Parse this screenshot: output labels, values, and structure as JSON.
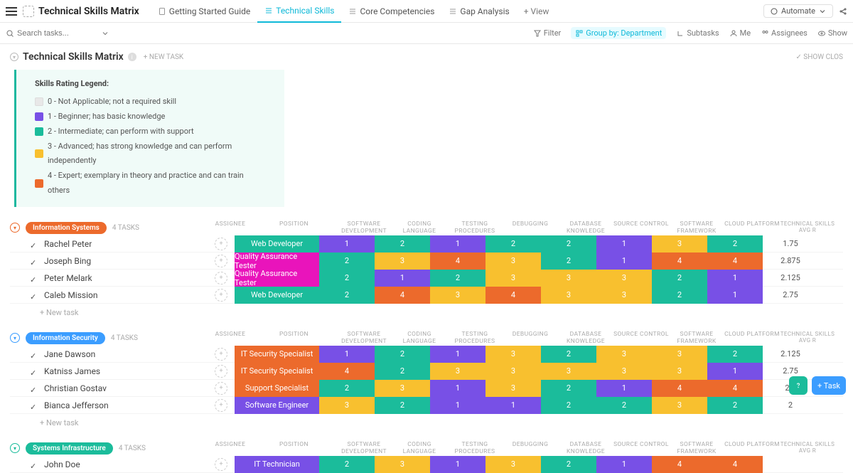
{
  "header": {
    "app_title": "Technical Skills Matrix",
    "tabs": [
      {
        "label": "Getting Started Guide"
      },
      {
        "label": "Technical Skills"
      },
      {
        "label": "Core Competencies"
      },
      {
        "label": "Gap Analysis"
      }
    ],
    "view_add": "+  View",
    "automate": "Automate"
  },
  "search": {
    "placeholder": "Search tasks..."
  },
  "filters": {
    "filter": "Filter",
    "group_by": "Group by: Department",
    "subtasks": "Subtasks",
    "me": "Me",
    "assignees": "Assignees",
    "show": "Show"
  },
  "page": {
    "title": "Technical Skills Matrix",
    "new_task": "+ NEW TASK",
    "show_closed": "✓ SHOW CLOS"
  },
  "legend": {
    "title": "Skills Rating Legend:",
    "rows": [
      {
        "swatch": "s0",
        "text": "0 - Not Applicable; not a required skill"
      },
      {
        "swatch": "s1",
        "text": "1 - Beginner;  has basic knowledge"
      },
      {
        "swatch": "s2",
        "text": "2 - Intermediate; can perform with support"
      },
      {
        "swatch": "s3",
        "text": "3 - Advanced; has strong knowledge and can perform independently"
      },
      {
        "swatch": "s4",
        "text": "4 - Expert; exemplary in theory and practice and can train others"
      }
    ]
  },
  "columns": {
    "assignee": "ASSIGNEE",
    "position": "POSITION",
    "skills": [
      "SOFTWARE DEVELOPMENT",
      "CODING LANGUAGE",
      "TESTING PROCEDURES",
      "DEBUGGING",
      "DATABASE KNOWLEDGE",
      "SOURCE CONTROL",
      "SOFTWARE FRAMEWORK",
      "CLOUD PLATFORM"
    ],
    "avg": "TECHNICAL SKILLS AVG R"
  },
  "skill_colors": {
    "1": "c-purple",
    "2": "c-teal",
    "3": "c-yellow",
    "4": "c-orange"
  },
  "groups": [
    {
      "name": "Information Systems",
      "count_label": "4 TASKS",
      "color": "#ec6a2c",
      "rows": [
        {
          "name": "Rachel Peter",
          "position": "Web Developer",
          "pos_color": "c-teal",
          "skills": [
            1,
            2,
            1,
            2,
            2,
            1,
            3,
            2
          ],
          "avg": "1.75"
        },
        {
          "name": "Joseph Bing",
          "position": "Quality Assurance Tester",
          "pos_color": "c-magenta",
          "skills": [
            2,
            3,
            4,
            3,
            2,
            1,
            4,
            4
          ],
          "avg": "2.875"
        },
        {
          "name": "Peter Melark",
          "position": "Quality Assurance Tester",
          "pos_color": "c-magenta",
          "skills": [
            2,
            1,
            2,
            3,
            3,
            3,
            2,
            1
          ],
          "avg": "2.125"
        },
        {
          "name": "Caleb Mission",
          "position": "Web Developer",
          "pos_color": "c-teal",
          "skills": [
            2,
            4,
            3,
            4,
            3,
            3,
            2,
            1
          ],
          "avg": "2.75"
        }
      ],
      "new_task": "+ New task"
    },
    {
      "name": "Information Security",
      "count_label": "4 TASKS",
      "color": "#3b9dff",
      "rows": [
        {
          "name": "Jane Dawson",
          "position": "IT Security Specialist",
          "pos_color": "c-orange",
          "skills": [
            1,
            2,
            1,
            3,
            2,
            3,
            3,
            2
          ],
          "avg": "2.125"
        },
        {
          "name": "Katniss James",
          "position": "IT Security Specialist",
          "pos_color": "c-orange",
          "skills": [
            4,
            2,
            3,
            3,
            3,
            3,
            3,
            1
          ],
          "avg": "2.75"
        },
        {
          "name": "Christian Gostav",
          "position": "Support Specialist",
          "pos_color": "c-orange",
          "skills": [
            2,
            3,
            1,
            3,
            2,
            1,
            4,
            4
          ],
          "avg": "2.5"
        },
        {
          "name": "Bianca Jefferson",
          "position": "Software Engineer",
          "pos_color": "c-purple",
          "skills": [
            3,
            2,
            1,
            1,
            2,
            2,
            3,
            2
          ],
          "avg": "2"
        }
      ],
      "new_task": "+ New task"
    },
    {
      "name": "Systems Infrastructure",
      "count_label": "4 TASKS",
      "color": "#1bbc9b",
      "rows": [
        {
          "name": "John Doe",
          "position": "IT Technician",
          "pos_color": "c-purple",
          "skills": [
            2,
            3,
            1,
            3,
            2,
            1,
            4,
            4
          ],
          "avg": ""
        }
      ],
      "new_task": ""
    }
  ],
  "float": {
    "task": "+  Task"
  }
}
